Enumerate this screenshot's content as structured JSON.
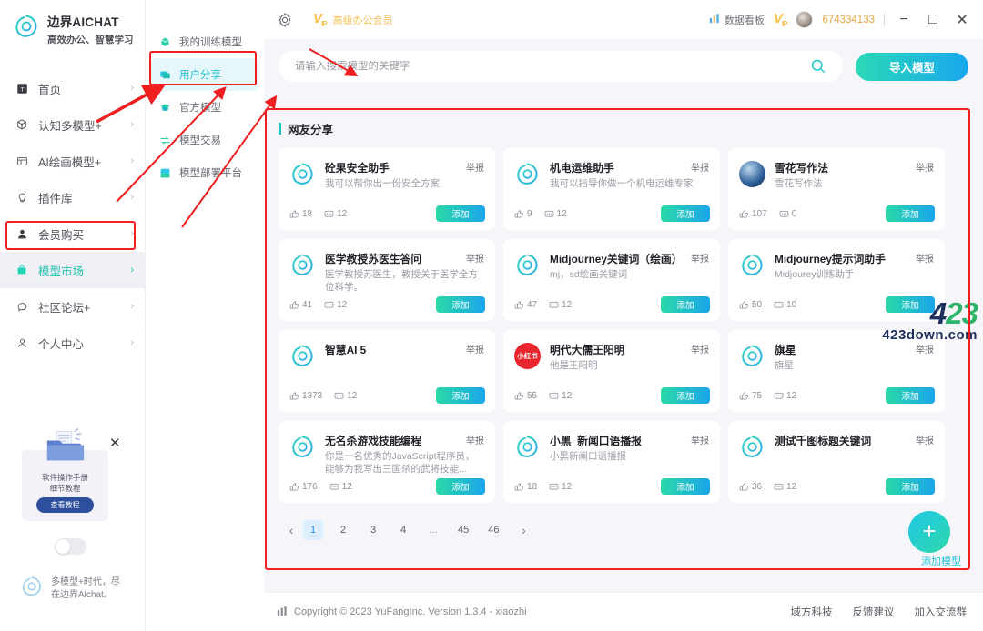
{
  "brand": {
    "title": "边界AICHAT",
    "subtitle": "高效办公、智慧学习",
    "logo_icon": "spiral-logo-icon"
  },
  "sidebar": {
    "items": [
      {
        "label": "首页",
        "icon": "home-icon",
        "arrow": "›",
        "active": false
      },
      {
        "label": "认知多模型+",
        "icon": "cube-icon",
        "arrow": "›",
        "active": false
      },
      {
        "label": "AI绘画模型+",
        "icon": "image-icon",
        "arrow": "›",
        "active": false
      },
      {
        "label": "插件库",
        "icon": "plug-icon",
        "arrow": "›",
        "active": false
      },
      {
        "label": "会员购买",
        "icon": "member-icon",
        "arrow": "›",
        "active": false
      },
      {
        "label": "模型市场",
        "icon": "shop-icon",
        "arrow": "›",
        "active": true
      },
      {
        "label": "社区论坛+",
        "icon": "chat-icon",
        "arrow": "›",
        "active": false
      },
      {
        "label": "个人中心",
        "icon": "user-icon",
        "arrow": "›",
        "active": false
      }
    ],
    "promo": {
      "line1": "软件操作手册",
      "line2": "细节教程",
      "button": "查看教程",
      "close_icon": "close-icon",
      "folder_icon": "folder-doc-icon"
    },
    "footer_slogan_1": "多模型+时代，尽",
    "footer_slogan_2": "在边界Alchat。"
  },
  "submenu": {
    "items": [
      {
        "label": "我的训练模型",
        "icon": "cube-green-icon",
        "active": false
      },
      {
        "label": "用户分享",
        "icon": "share-chat-icon",
        "active": true
      },
      {
        "label": "官方模型",
        "icon": "graduation-cap-icon",
        "active": false
      },
      {
        "label": "模型交易",
        "icon": "trade-icon",
        "active": false
      },
      {
        "label": "模型部署平台",
        "icon": "deploy-icon",
        "active": false
      }
    ]
  },
  "topbar": {
    "gear_icon": "gear-icon",
    "vip_badge": "VIP",
    "vip_label": "高级办公会员",
    "dashboard_label": "数据看板",
    "dashboard_icon": "bar-chart-icon",
    "vip_badge_2": "VIP",
    "avatar": "user-avatar",
    "user_id": "674334133",
    "minimize": "−",
    "maximize": "□",
    "close": "✕"
  },
  "search": {
    "placeholder": "请输入搜索模型的关键字",
    "value": "",
    "icon": "search-icon",
    "import_button": "导入模型"
  },
  "panel": {
    "title": "网友分享"
  },
  "cards": [
    {
      "title": "砼果安全助手",
      "desc": "我可以帮你出一份安全方案",
      "likes": "18",
      "comments": "12",
      "report": "举报",
      "add": "添加",
      "avatar": "spiral-logo-icon",
      "avatar_type": "spiral"
    },
    {
      "title": "机电运维助手",
      "desc": "我可以指导你做一个机电运维专家",
      "likes": "9",
      "comments": "12",
      "report": "举报",
      "add": "添加",
      "avatar": "spiral-logo-icon",
      "avatar_type": "spiral"
    },
    {
      "title": "雪花写作法",
      "desc": "雪花写作法",
      "likes": "107",
      "comments": "0",
      "report": "举报",
      "add": "添加",
      "avatar": "photo-avatar",
      "avatar_type": "photo"
    },
    {
      "title": "医学教授苏医生答问",
      "desc": "医学教授苏医生，教授关于医学全方位科学。",
      "likes": "41",
      "comments": "12",
      "report": "举报",
      "add": "添加",
      "avatar": "spiral-logo-icon",
      "avatar_type": "spiral"
    },
    {
      "title": "Midjourney关键词（绘画）",
      "desc": "mj，sd绘画关键词",
      "likes": "47",
      "comments": "12",
      "report": "举报",
      "add": "添加",
      "avatar": "spiral-logo-icon",
      "avatar_type": "spiral"
    },
    {
      "title": "Midjourney提示词助手",
      "desc": "Midjourey训练助手",
      "likes": "50",
      "comments": "10",
      "report": "举报",
      "add": "添加",
      "avatar": "spiral-logo-icon",
      "avatar_type": "spiral"
    },
    {
      "title": "智慧AI 5",
      "desc": "",
      "likes": "1373",
      "comments": "12",
      "report": "举报",
      "add": "添加",
      "avatar": "spiral-logo-icon",
      "avatar_type": "spiral"
    },
    {
      "title": "明代大儒王阳明",
      "desc": "他是王阳明",
      "likes": "55",
      "comments": "12",
      "report": "举报",
      "add": "添加",
      "avatar": "xiaohongshu-avatar",
      "avatar_type": "xhs",
      "avatar_text": "小红书"
    },
    {
      "title": "旗星",
      "desc": "旗星",
      "likes": "75",
      "comments": "12",
      "report": "举报",
      "add": "添加",
      "avatar": "spiral-logo-icon",
      "avatar_type": "spiral"
    },
    {
      "title": "无名杀游戏技能编程",
      "desc": "你是一名优秀的JavaScript程序员，能够为我写出三国杀的武将技能...",
      "likes": "176",
      "comments": "12",
      "report": "举报",
      "add": "添加",
      "avatar": "spiral-logo-icon",
      "avatar_type": "spiral"
    },
    {
      "title": "小黑_新闻口语播报",
      "desc": "小黑新闻口语播报",
      "likes": "18",
      "comments": "12",
      "report": "举报",
      "add": "添加",
      "avatar": "spiral-logo-icon",
      "avatar_type": "spiral"
    },
    {
      "title": "测试千图标题关键词",
      "desc": "",
      "likes": "36",
      "comments": "12",
      "report": "举报",
      "add": "添加",
      "avatar": "spiral-logo-icon",
      "avatar_type": "spiral"
    }
  ],
  "pagination": {
    "prev": "‹",
    "next": "›",
    "pages": [
      "1",
      "2",
      "3",
      "4",
      "...",
      "45",
      "46"
    ],
    "current": "1"
  },
  "fab": {
    "plus": "+",
    "label": "添加模型"
  },
  "footer": {
    "copyright": "Copyright © 2023 YuFangInc. Version 1.3.4 - xiaozhi",
    "chart_icon": "bar-chart-icon",
    "links": [
      "域方科技",
      "反馈建议",
      "加入交流群"
    ]
  },
  "watermark": {
    "line1_a": "4",
    "line1_b": "23",
    "line2": "423down.com"
  },
  "colors": {
    "accent_teal": "#1ec8c8",
    "accent_blue": "#18a7ee",
    "vip_gold": "#f3bf52",
    "highlight_red": "#f01e1e",
    "active_bg": "#e6f7fb"
  }
}
